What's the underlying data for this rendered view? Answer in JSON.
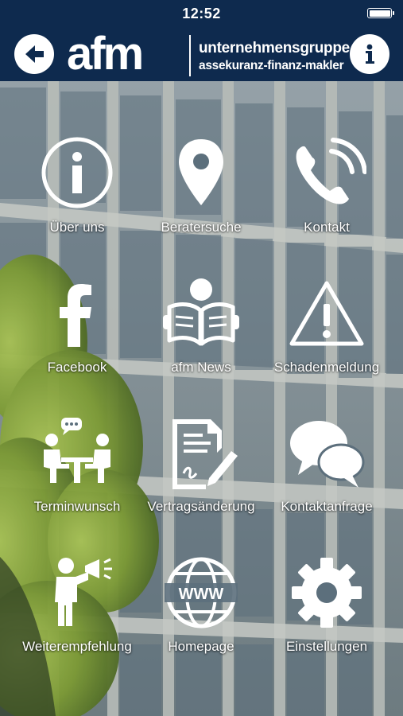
{
  "status_bar": {
    "time": "12:52"
  },
  "header": {
    "logo_mark": "afm",
    "logo_line1": "unternehmensgruppe",
    "logo_line2": "assekuranz-finanz-makler",
    "back_icon": "arrow-left-icon",
    "info_icon": "info-icon"
  },
  "menu": {
    "items": [
      {
        "label": "Über uns",
        "icon": "info-circle-icon"
      },
      {
        "label": "Beratersuche",
        "icon": "map-pin-icon"
      },
      {
        "label": "Kontakt",
        "icon": "phone-icon"
      },
      {
        "label": "Facebook",
        "icon": "facebook-icon"
      },
      {
        "label": "afm News",
        "icon": "reader-icon"
      },
      {
        "label": "Schadenmeldung",
        "icon": "warning-icon"
      },
      {
        "label": "Terminwunsch",
        "icon": "meeting-icon"
      },
      {
        "label": "Vertragsänderung",
        "icon": "contract-edit-icon"
      },
      {
        "label": "Kontaktanfrage",
        "icon": "chat-bubbles-icon"
      },
      {
        "label": "Weiterempfehlung",
        "icon": "megaphone-person-icon"
      },
      {
        "label": "Homepage",
        "icon": "globe-www-icon"
      },
      {
        "label": "Einstellungen",
        "icon": "gear-icon"
      }
    ]
  },
  "colors": {
    "header_bg": "#0e2a4e",
    "icon": "#ffffff",
    "foliage": "#8fae3a"
  }
}
